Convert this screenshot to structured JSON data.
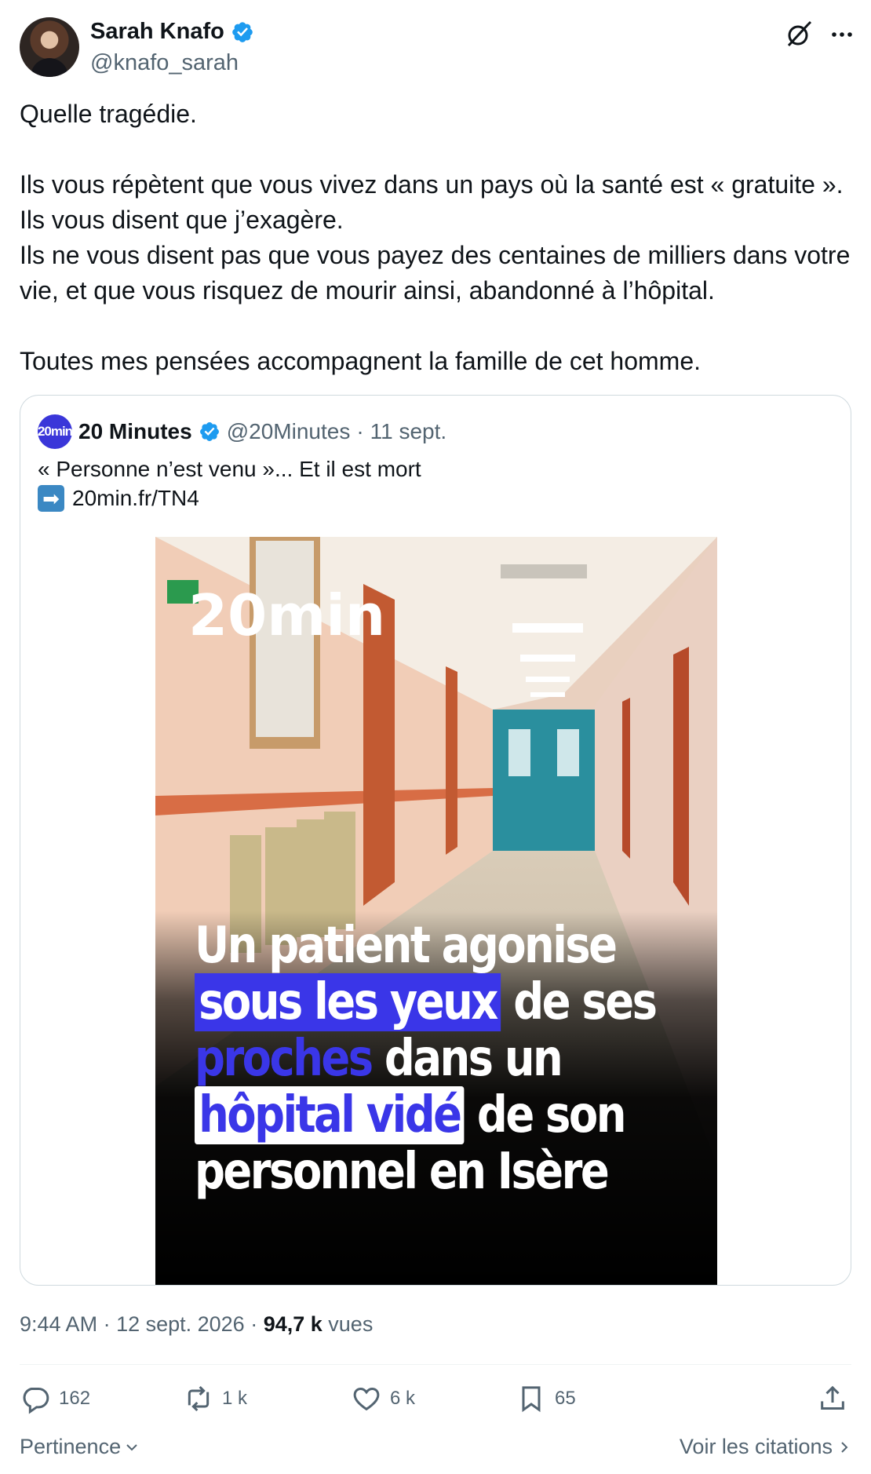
{
  "author": {
    "name": "Sarah Knafo",
    "handle": "@knafo_sarah"
  },
  "tweet": {
    "text": "Quelle tragédie.\n\nIls vous répètent que vous vivez dans un pays où la santé est « gratuite ».\nIls vous disent que j’exagère.\nIls ne vous disent pas que vous payez des centaines de milliers dans votre vie, et que vous risquez de mourir ainsi, abandonné à l’hôpital.\n\nToutes mes pensées accompagnent la famille de cet homme."
  },
  "quote": {
    "avatar_text": "20min",
    "name": "20 Minutes",
    "handle": "@20Minutes",
    "separator": "·",
    "date": "11 sept.",
    "line1": "« Personne n’est venu »... Et il est mort",
    "arrow": "➡",
    "link": "20min.fr/TN4",
    "image": {
      "logo": "20min",
      "headline": {
        "l1": "Un patient agonise",
        "l2_box": "sous les yeux",
        "l2_rest": " de ses",
        "l3_blue": "proches",
        "l3_rest": " dans un",
        "l4_box": "hôpital vidé",
        "l4_rest": " de son",
        "l5": "personnel en Isère"
      }
    }
  },
  "meta": {
    "time": "9:44 AM",
    "sep1": " · ",
    "date": "12 sept. 2026",
    "sep2": " · ",
    "views": "94,7 k",
    "views_label": " vues"
  },
  "actions": {
    "replies": "162",
    "reposts": "1 k",
    "likes": "6 k",
    "bookmarks": "65"
  },
  "footer": {
    "sort_label": "Pertinence",
    "quotes_label": "Voir les citations"
  },
  "colors": {
    "verified": "#1d9bf0",
    "brand_20min": "#3a36e8",
    "text_secondary": "#536471"
  }
}
